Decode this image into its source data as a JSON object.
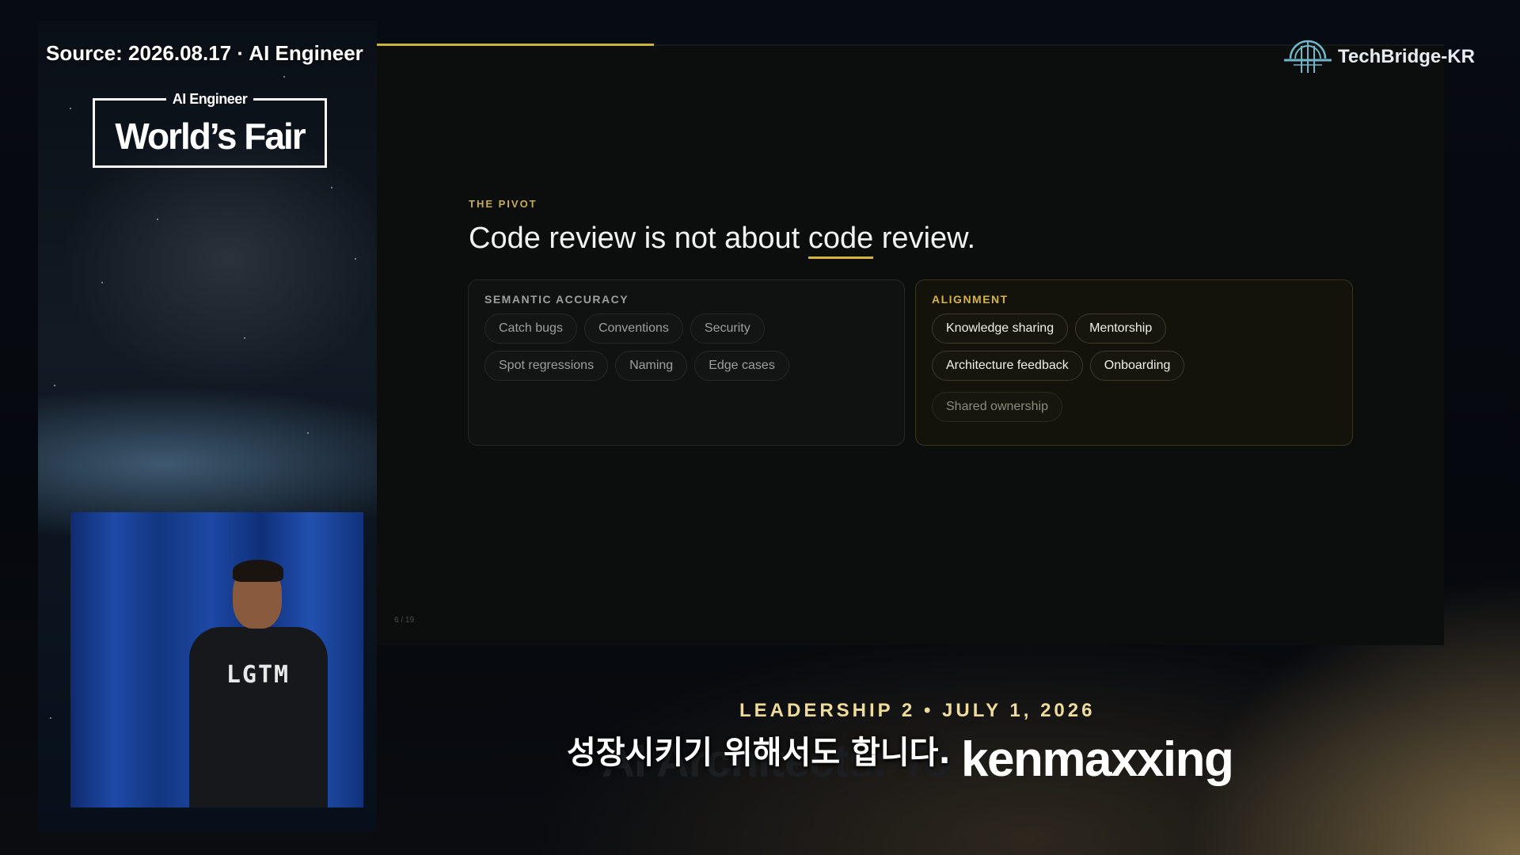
{
  "overlay": {
    "source": "Source: 2026.08.17 · AI Engineer",
    "logo_top": "AI Engineer",
    "logo_main": "World’s Fair",
    "brand": "TechBridge-KR"
  },
  "speaker": {
    "shirt_text": "LGTM"
  },
  "slide": {
    "eyebrow": "THE PIVOT",
    "headline_before": "Code review is not about ",
    "headline_highlight": "code",
    "headline_after": " review.",
    "progress": 0.26,
    "page_number": "6 / 19",
    "left_card": {
      "title": "SEMANTIC ACCURACY",
      "rows": [
        [
          "Catch bugs",
          "Conventions",
          "Security"
        ],
        [
          "Spot regressions",
          "Naming",
          "Edge cases"
        ]
      ]
    },
    "right_card": {
      "title": "ALIGNMENT",
      "rows": [
        [
          "Knowledge sharing",
          "Mentorship"
        ],
        [
          "Architecture feedback",
          "Onboarding"
        ],
        [
          "Shared ownership"
        ]
      ]
    }
  },
  "lower_third": {
    "event": "LEADERSHIP 2 • JULY 1, 2026",
    "title_ghost": "AI Architects: To",
    "title_end": "kenmaxxing",
    "subtitle": "성장시키기 위해서도 합니다."
  },
  "colors": {
    "accent_gold": "#d6b43f",
    "slide_bg": "#0c0e0d",
    "video_blue": "#1e4aa8"
  },
  "icons": {
    "brand_logo": "bridge-globe-icon"
  }
}
